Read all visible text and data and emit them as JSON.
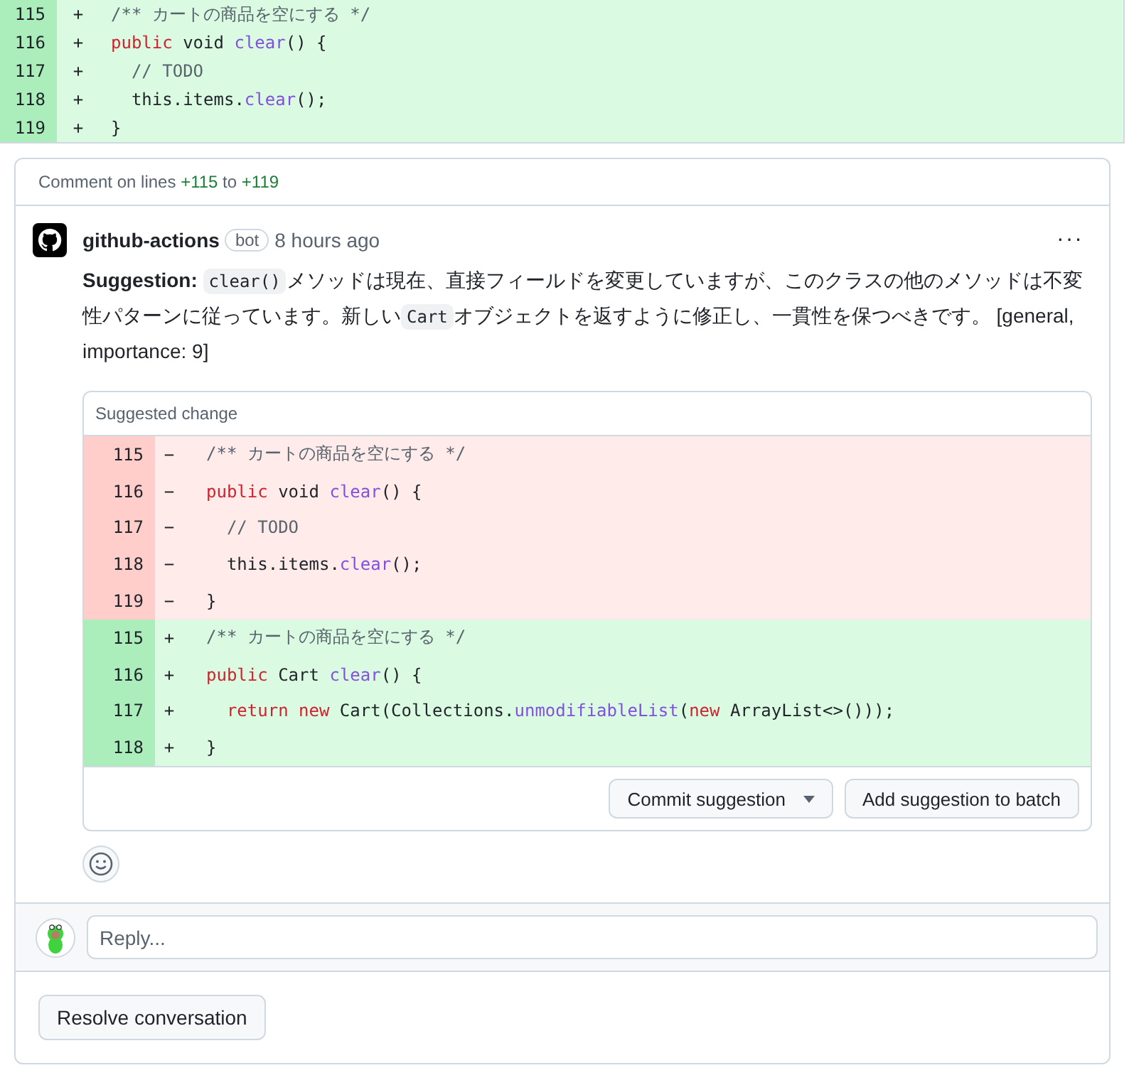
{
  "diff_lines": [
    {
      "number": "115",
      "sign": "+",
      "kind": "added",
      "tokens": [
        {
          "kind": "comment",
          "text": "/** カートの商品を空にする */"
        }
      ]
    },
    {
      "number": "116",
      "sign": "+",
      "kind": "added",
      "tokens": [
        {
          "kind": "keyword",
          "text": "public"
        },
        {
          "kind": "plain",
          "text": " void "
        },
        {
          "kind": "function",
          "text": "clear"
        },
        {
          "kind": "plain",
          "text": "() {"
        }
      ]
    },
    {
      "number": "117",
      "sign": "+",
      "kind": "added",
      "tokens": [
        {
          "kind": "comment",
          "text": "  // TODO"
        }
      ]
    },
    {
      "number": "118",
      "sign": "+",
      "kind": "added",
      "tokens": [
        {
          "kind": "plain",
          "text": "  this.items."
        },
        {
          "kind": "function",
          "text": "clear"
        },
        {
          "kind": "plain",
          "text": "();"
        }
      ]
    },
    {
      "number": "119",
      "sign": "+",
      "kind": "added",
      "tokens": [
        {
          "kind": "plain",
          "text": "}"
        }
      ]
    }
  ],
  "thread": {
    "header": {
      "prefix": "Comment on lines",
      "start": "+115",
      "middle": "to",
      "end": "+119"
    },
    "comment": {
      "author": "github-actions",
      "badge": "bot",
      "time": "8 hours ago",
      "more": "···",
      "body": [
        {
          "kind": "bold",
          "text": "Suggestion: "
        },
        {
          "kind": "code",
          "text": "clear()"
        },
        {
          "kind": "text",
          "text": "メソッドは現在、直接フィールドを変更していますが、このクラスの他のメソッドは不変性パターンに従っています。新しい"
        },
        {
          "kind": "code",
          "text": "Cart"
        },
        {
          "kind": "text",
          "text": "オブジェクトを返すように修正し、一貫性を保つべきです。 [general, importance: 9]"
        }
      ]
    },
    "suggestion": {
      "title": "Suggested change",
      "lines": [
        {
          "number": "115",
          "sign": "−",
          "kind": "deleted",
          "tokens": [
            {
              "kind": "comment",
              "text": "/** カートの商品を空にする */"
            }
          ]
        },
        {
          "number": "116",
          "sign": "−",
          "kind": "deleted",
          "tokens": [
            {
              "kind": "keyword",
              "text": "public"
            },
            {
              "kind": "plain",
              "text": " void "
            },
            {
              "kind": "function",
              "text": "clear"
            },
            {
              "kind": "plain",
              "text": "() {"
            }
          ]
        },
        {
          "number": "117",
          "sign": "−",
          "kind": "deleted",
          "tokens": [
            {
              "kind": "comment",
              "text": "  // TODO"
            }
          ]
        },
        {
          "number": "118",
          "sign": "−",
          "kind": "deleted",
          "tokens": [
            {
              "kind": "plain",
              "text": "  this.items."
            },
            {
              "kind": "function",
              "text": "clear"
            },
            {
              "kind": "plain",
              "text": "();"
            }
          ]
        },
        {
          "number": "119",
          "sign": "−",
          "kind": "deleted",
          "tokens": [
            {
              "kind": "plain",
              "text": "}"
            }
          ]
        },
        {
          "number": "115",
          "sign": "+",
          "kind": "added",
          "tokens": [
            {
              "kind": "comment",
              "text": "/** カートの商品を空にする */"
            }
          ]
        },
        {
          "number": "116",
          "sign": "+",
          "kind": "added",
          "tokens": [
            {
              "kind": "keyword",
              "text": "public"
            },
            {
              "kind": "plain",
              "text": " Cart "
            },
            {
              "kind": "function",
              "text": "clear"
            },
            {
              "kind": "plain",
              "text": "() {"
            }
          ]
        },
        {
          "number": "117",
          "sign": "+",
          "kind": "added",
          "tokens": [
            {
              "kind": "keyword",
              "text": "  return new"
            },
            {
              "kind": "plain",
              "text": " Cart(Collections."
            },
            {
              "kind": "function",
              "text": "unmodifiableList"
            },
            {
              "kind": "plain",
              "text": "("
            },
            {
              "kind": "keyword",
              "text": "new"
            },
            {
              "kind": "plain",
              "text": " ArrayList<>()));"
            }
          ]
        },
        {
          "number": "118",
          "sign": "+",
          "kind": "added",
          "tokens": [
            {
              "kind": "plain",
              "text": "}"
            }
          ]
        }
      ],
      "buttons": [
        {
          "label": "Commit suggestion",
          "kind": "dropdown"
        },
        {
          "label": "Add suggestion to batch",
          "kind": "plain"
        }
      ]
    },
    "reply": {
      "placeholder": "Reply..."
    },
    "resolve_button": "Resolve conversation"
  }
}
